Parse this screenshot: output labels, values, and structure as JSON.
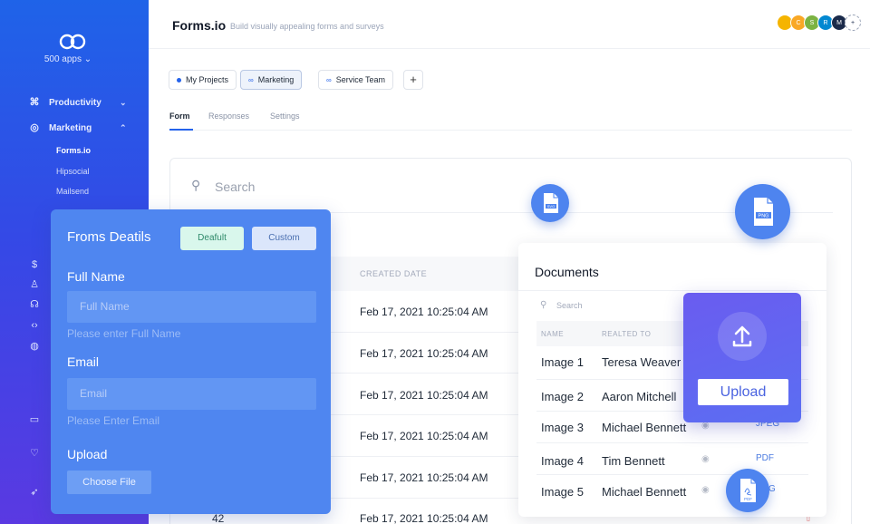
{
  "sidebar": {
    "apps_label": "500 apps",
    "nav": [
      {
        "label": "Productivity",
        "icon": "command-icon"
      },
      {
        "label": "Marketing",
        "icon": "globe-icon"
      }
    ],
    "sub_items": [
      "Forms.io",
      "Hipsocial",
      "Mailsend"
    ],
    "side_icons": [
      "dollar-icon",
      "user-icon",
      "headset-icon",
      "code-icon",
      "globe-icon",
      "monitor-icon",
      "heart-icon",
      "rocket-icon"
    ]
  },
  "header": {
    "title": "Forms.io",
    "tagline": "Build visually appealing forms and surveys",
    "avatars": [
      {
        "letter": "",
        "color": "#f5b400"
      },
      {
        "letter": "C",
        "color": "#f9a825"
      },
      {
        "letter": "S",
        "color": "#7cb342"
      },
      {
        "letter": "R",
        "color": "#0288d1"
      },
      {
        "letter": "M",
        "color": "#1a2a4a"
      }
    ]
  },
  "project_tabs": [
    "My Projects",
    "Marketing",
    "Service Team"
  ],
  "add_tab": "+",
  "section_tabs": [
    "Form",
    "Responses",
    "Settings"
  ],
  "main": {
    "search_placeholder": "Search",
    "column_created": "CREATED DATE",
    "dates": [
      "Feb 17, 2021 10:25:04 AM",
      "Feb 17, 2021 10:25:04 AM",
      "Feb 17, 2021 10:25:04 AM",
      "Feb 17, 2021 10:25:04 AM",
      "Feb 17, 2021 10:25:04 AM",
      "Feb 17, 2021 10:25:04 AM"
    ],
    "row_number": "42"
  },
  "form_panel": {
    "title": "Froms Deatils",
    "default_label": "Deafult",
    "custom_label": "Custom",
    "full_name_label": "Full Name",
    "full_name_placeholder": "Full Name",
    "full_name_help": "Please enter Full Name",
    "email_label": "Email",
    "email_placeholder": "Email",
    "email_help": "Please Enter Email",
    "upload_label": "Upload",
    "choose_file": "Choose File"
  },
  "documents": {
    "title": "Documents",
    "search_placeholder": "Search",
    "col_name": "NAME",
    "col_related": "REALTED TO",
    "rows": [
      {
        "name": "Image 1",
        "related": "Teresa Weaver",
        "type": ""
      },
      {
        "name": "Image 2",
        "related": "Aaron Mitchell",
        "type": ""
      },
      {
        "name": "Image 3",
        "related": "Michael Bennett",
        "type": "JPEG"
      },
      {
        "name": "Image 4",
        "related": "Tim Bennett",
        "type": "PDF"
      },
      {
        "name": "Image 5",
        "related": "Michael Bennett",
        "type": "G"
      }
    ]
  },
  "upload_card": {
    "button_label": "Upload"
  },
  "file_icons": [
    "SVG",
    "PNG",
    "PDF"
  ]
}
